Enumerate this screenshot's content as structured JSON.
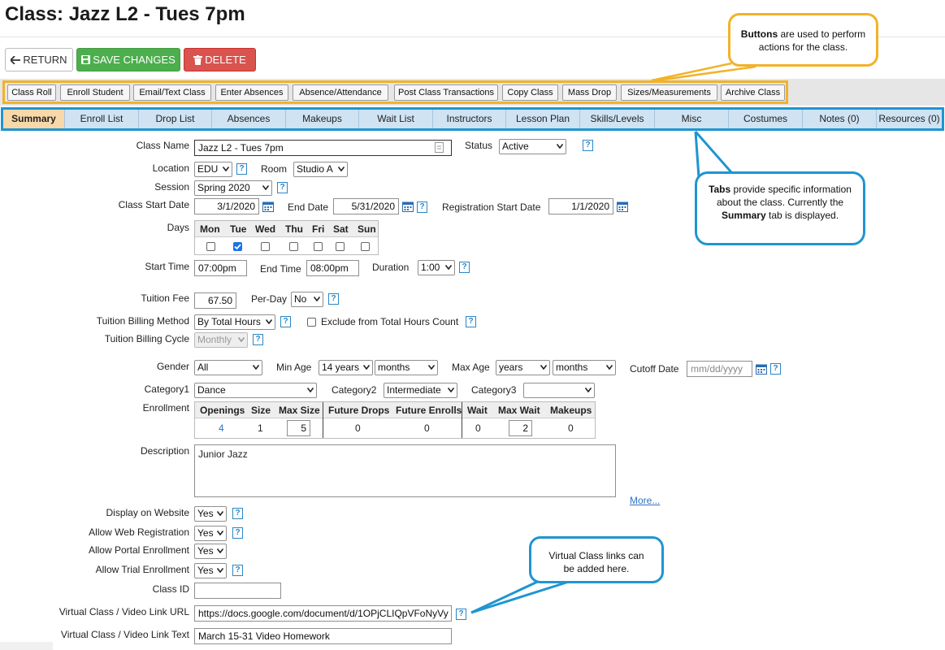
{
  "page": {
    "title": "Class: Jazz L2 - Tues 7pm"
  },
  "top_buttons": {
    "return": "RETURN",
    "save": "SAVE CHANGES",
    "delete": "DELETE"
  },
  "action_buttons": [
    "Class Roll",
    "Enroll Student",
    "Email/Text Class",
    "Enter Absences",
    "Absence/Attendance",
    "Post Class Transactions",
    "Copy Class",
    "Mass Drop",
    "Sizes/Measurements",
    "Archive Class"
  ],
  "tabs": [
    "Summary",
    "Enroll List",
    "Drop List",
    "Absences",
    "Makeups",
    "Wait List",
    "Instructors",
    "Lesson Plan",
    "Skills/Levels",
    "Misc",
    "Costumes",
    "Notes (0)",
    "Resources (0)"
  ],
  "active_tab": "Summary",
  "form": {
    "class_name": {
      "label": "Class Name",
      "value": "Jazz L2 - Tues 7pm"
    },
    "status": {
      "label": "Status",
      "value": "Active"
    },
    "location": {
      "label": "Location",
      "value": "EDU"
    },
    "room": {
      "label": "Room",
      "value": "Studio A"
    },
    "session": {
      "label": "Session",
      "value": "Spring 2020"
    },
    "class_start_date": {
      "label": "Class Start Date",
      "value": "3/1/2020"
    },
    "end_date": {
      "label": "End Date",
      "value": "5/31/2020"
    },
    "registration_start_date": {
      "label": "Registration Start Date",
      "value": "1/1/2020"
    },
    "days": {
      "label": "Days",
      "names": [
        "Mon",
        "Tue",
        "Wed",
        "Thu",
        "Fri",
        "Sat",
        "Sun"
      ],
      "checked": [
        false,
        true,
        false,
        false,
        false,
        false,
        false
      ]
    },
    "start_time": {
      "label": "Start Time",
      "value": "07:00pm"
    },
    "end_time": {
      "label": "End Time",
      "value": "08:00pm"
    },
    "duration": {
      "label": "Duration",
      "value": "1:00"
    },
    "tuition_fee": {
      "label": "Tuition Fee",
      "value": "67.50"
    },
    "per_day": {
      "label": "Per-Day",
      "value": "No"
    },
    "tuition_billing_method": {
      "label": "Tuition Billing Method",
      "value": "By Total Hours"
    },
    "exclude_total_hours": {
      "label": "Exclude from Total Hours Count",
      "checked": false
    },
    "tuition_billing_cycle": {
      "label": "Tuition Billing Cycle",
      "value": "Monthly"
    },
    "gender": {
      "label": "Gender",
      "value": "All"
    },
    "min_age": {
      "label": "Min Age",
      "years": "14 years",
      "months": "months"
    },
    "max_age": {
      "label": "Max Age",
      "years": "years",
      "months": "months"
    },
    "cutoff_date": {
      "label": "Cutoff Date",
      "placeholder": "mm/dd/yyyy"
    },
    "category1": {
      "label": "Category1",
      "value": "Dance"
    },
    "category2": {
      "label": "Category2",
      "value": "Intermediate"
    },
    "category3": {
      "label": "Category3",
      "value": ""
    },
    "enrollment": {
      "label": "Enrollment",
      "headers": [
        "Openings",
        "Size",
        "Max Size",
        "Future Drops",
        "Future Enrolls",
        "Wait",
        "Max Wait",
        "Makeups"
      ],
      "values": [
        "4",
        "1",
        "5",
        "0",
        "0",
        "0",
        "2",
        "0"
      ]
    },
    "description": {
      "label": "Description",
      "value": "Junior Jazz",
      "more_link": "More..."
    },
    "display_on_website": {
      "label": "Display on Website",
      "value": "Yes"
    },
    "allow_web_registration": {
      "label": "Allow Web Registration",
      "value": "Yes"
    },
    "allow_portal_enrollment": {
      "label": "Allow Portal Enrollment",
      "value": "Yes"
    },
    "allow_trial_enrollment": {
      "label": "Allow Trial Enrollment",
      "value": "Yes"
    },
    "class_id": {
      "label": "Class ID",
      "value": ""
    },
    "virtual_link_url": {
      "label": "Virtual Class / Video Link URL",
      "value": "https://docs.google.com/document/d/1OPjCLIQpVFoNyVy"
    },
    "virtual_link_text": {
      "label": "Virtual Class / Video Link Text",
      "value": "March 15-31 Video Homework"
    }
  },
  "callouts": {
    "buttons": {
      "bold": "Buttons",
      "rest": " are used to perform actions for the class."
    },
    "tabs": {
      "bold1": "Tabs",
      "rest1": " provide specific information about the class. Currently the ",
      "bold2": "Summary",
      "rest2": " tab is displayed."
    },
    "virtual": {
      "text": "Virtual Class links can be added here."
    }
  },
  "colors": {
    "yellow_highlight": "#f2b229",
    "blue_highlight": "#1f95d1",
    "save_green": "#4cae4c",
    "delete_red": "#d9534f",
    "active_tab": "#f8d8a8"
  }
}
